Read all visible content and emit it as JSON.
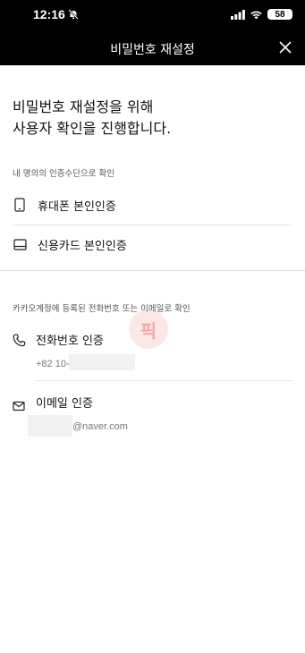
{
  "status_bar": {
    "time": "12:16",
    "battery": "58",
    "icons": [
      "bell-slash-icon",
      "signal-icon",
      "wifi-icon",
      "battery-icon"
    ]
  },
  "nav": {
    "title": "비밀번호 재설정",
    "close_icon": "close-icon"
  },
  "heading": {
    "line1": "비밀번호 재설정을 위해",
    "line2": "사용자 확인을 진행합니다."
  },
  "section_own": {
    "label": "내 명의의 인증수단으로 확인",
    "items": [
      {
        "label": "휴대폰 본인인증",
        "icon": "mobile-phone-icon"
      },
      {
        "label": "신용카드 본인인증",
        "icon": "credit-card-icon"
      }
    ]
  },
  "section_kakao": {
    "label": "카카오계정에 등록된 전화번호 또는 이메일로 확인",
    "phone": {
      "label": "전화번호 인증",
      "value": "+82 10-",
      "icon": "phone-icon"
    },
    "email": {
      "label": "이메일 인증",
      "value": "@naver.com",
      "icon": "mail-icon"
    }
  },
  "watermark": "픽",
  "colors": {
    "header_bg": "#000000",
    "text": "#111111",
    "sub_text": "#777777",
    "watermark": "#e65a5a"
  }
}
